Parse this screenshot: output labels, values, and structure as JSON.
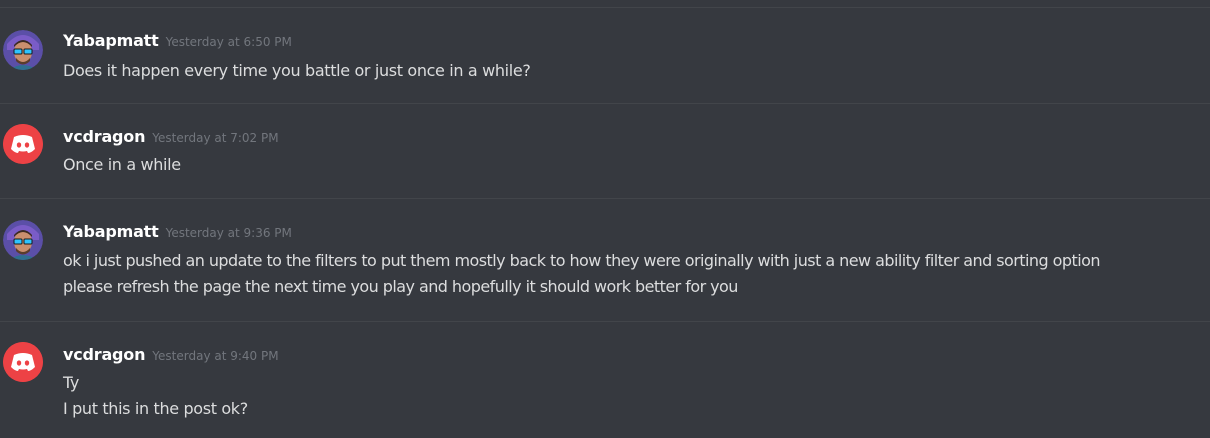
{
  "colors": {
    "background": "#36393f",
    "divider": "#42454a",
    "username": "#ffffff",
    "timestamp": "#72767d",
    "text": "#dcddde",
    "discord_avatar_bg": "#ed4245"
  },
  "messages": [
    {
      "author": "Yabapmatt",
      "avatar_icon": "user-portrait-avatar",
      "timestamp": "Yesterday at 6:50 PM",
      "lines": [
        "Does it happen every time you battle or just once in a while?"
      ]
    },
    {
      "author": "vcdragon",
      "avatar_icon": "discord-default-avatar",
      "timestamp": "Yesterday at 7:02 PM",
      "lines": [
        "Once in a while"
      ]
    },
    {
      "author": "Yabapmatt",
      "avatar_icon": "user-portrait-avatar",
      "timestamp": "Yesterday at 9:36 PM",
      "lines": [
        "ok i just pushed an update to the filters to put them mostly back to how they were originally with just a new ability filter and sorting option",
        "please refresh the page the next time you play and hopefully it should work better for you"
      ]
    },
    {
      "author": "vcdragon",
      "avatar_icon": "discord-default-avatar",
      "timestamp": "Yesterday at 9:40 PM",
      "lines": [
        "Ty",
        "I put this in the post ok?"
      ]
    }
  ]
}
